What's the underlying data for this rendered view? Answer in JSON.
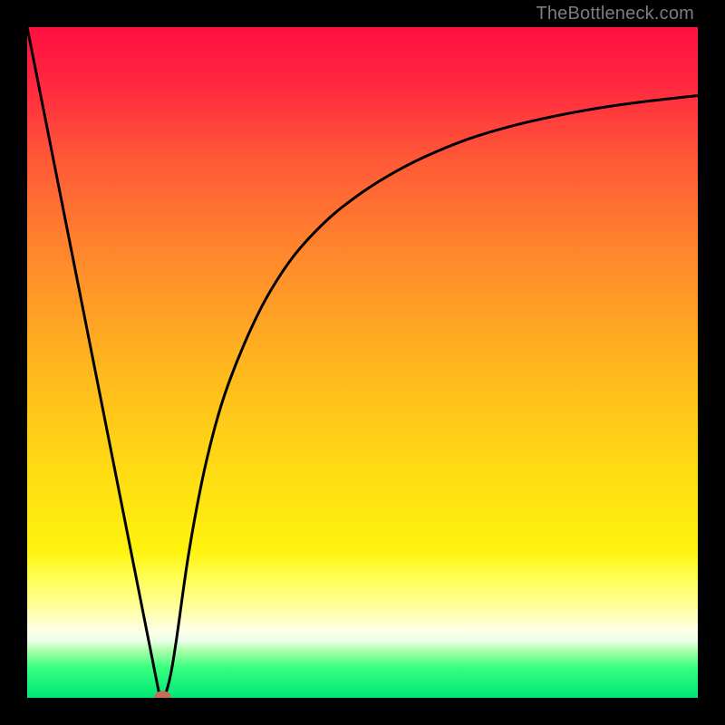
{
  "watermark": "TheBottleneck.com",
  "chart_data": {
    "type": "line",
    "title": "",
    "xlabel": "",
    "ylabel": "",
    "xlim": [
      0,
      100
    ],
    "ylim": [
      0,
      100
    ],
    "background_gradient": [
      {
        "stop": 0.0,
        "color": "#ff103f"
      },
      {
        "stop": 0.08,
        "color": "#ff2640"
      },
      {
        "stop": 0.2,
        "color": "#ff5a37"
      },
      {
        "stop": 0.35,
        "color": "#ff8b2c"
      },
      {
        "stop": 0.5,
        "color": "#ffb51f"
      },
      {
        "stop": 0.65,
        "color": "#ffd915"
      },
      {
        "stop": 0.78,
        "color": "#fff30e"
      },
      {
        "stop": 0.82,
        "color": "#ffff52"
      },
      {
        "stop": 0.87,
        "color": "#ffffa8"
      },
      {
        "stop": 0.9,
        "color": "#ffffe8"
      },
      {
        "stop": 0.916,
        "color": "#e8ffe8"
      },
      {
        "stop": 0.93,
        "color": "#a8ffa8"
      },
      {
        "stop": 0.955,
        "color": "#38ff80"
      },
      {
        "stop": 1.0,
        "color": "#00e676"
      }
    ],
    "series": [
      {
        "name": "bottleneck",
        "x": [
          0,
          2,
          4,
          6,
          8,
          10,
          12,
          14,
          16,
          18,
          19.6,
          20.2,
          20.8,
          21.5,
          22.3,
          24,
          26,
          28,
          30,
          33,
          36,
          40,
          45,
          50,
          55,
          60,
          66,
          72,
          78,
          85,
          92,
          100
        ],
        "y": [
          100,
          89.9,
          79.8,
          69.7,
          59.6,
          49.5,
          39.4,
          29.3,
          19.2,
          9.1,
          1.0,
          0.0,
          1.1,
          4.0,
          9.0,
          21.0,
          32.0,
          40.4,
          46.8,
          54.2,
          60.2,
          66.2,
          71.5,
          75.4,
          78.5,
          81.0,
          83.4,
          85.2,
          86.6,
          87.9,
          88.9,
          89.8
        ]
      }
    ],
    "marker": {
      "x": 20.2,
      "y": 0.2,
      "color": "#cc6b5a"
    }
  }
}
